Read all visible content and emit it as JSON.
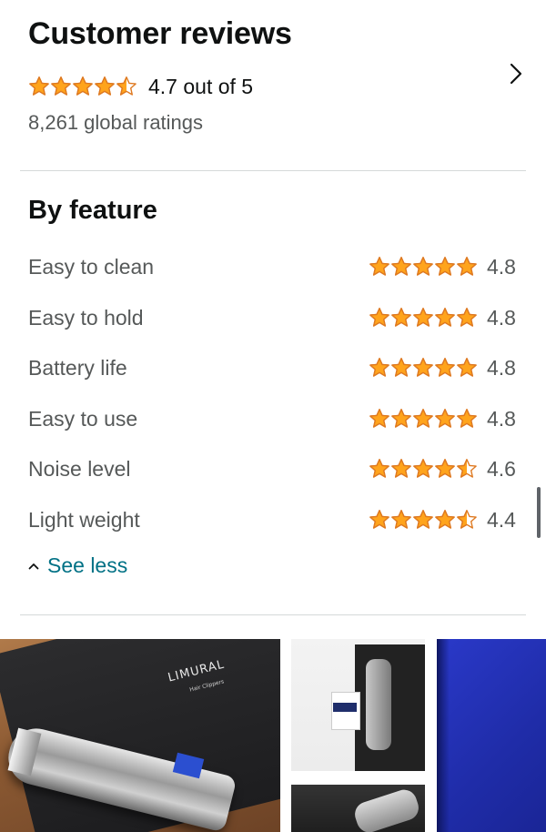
{
  "header": {
    "title": "Customer reviews",
    "overall_rating": 4.7,
    "overall_text": "4.7 out of 5",
    "global_ratings": "8,261 global ratings"
  },
  "by_feature": {
    "title": "By feature",
    "items": [
      {
        "label": "Easy to clean",
        "rating": 4.8,
        "score": "4.8"
      },
      {
        "label": "Easy to hold",
        "rating": 4.8,
        "score": "4.8"
      },
      {
        "label": "Battery life",
        "rating": 4.8,
        "score": "4.8"
      },
      {
        "label": "Easy to use",
        "rating": 4.8,
        "score": "4.8"
      },
      {
        "label": "Noise level",
        "rating": 4.6,
        "score": "4.6"
      },
      {
        "label": "Light weight",
        "rating": 4.4,
        "score": "4.4"
      }
    ],
    "see_less_label": "See less"
  },
  "photos": {
    "brand_text": "LIMURAL",
    "brand_sub": "Hair Clippers"
  },
  "colors": {
    "star": "#ffa41c",
    "star_stroke": "#de7921",
    "link": "#007185",
    "muted_text": "#565959",
    "divider": "#d5d9d9"
  },
  "icons": {
    "chevron": "chevron-right-icon",
    "caret": "caret-up-icon",
    "star": "star-icon"
  }
}
